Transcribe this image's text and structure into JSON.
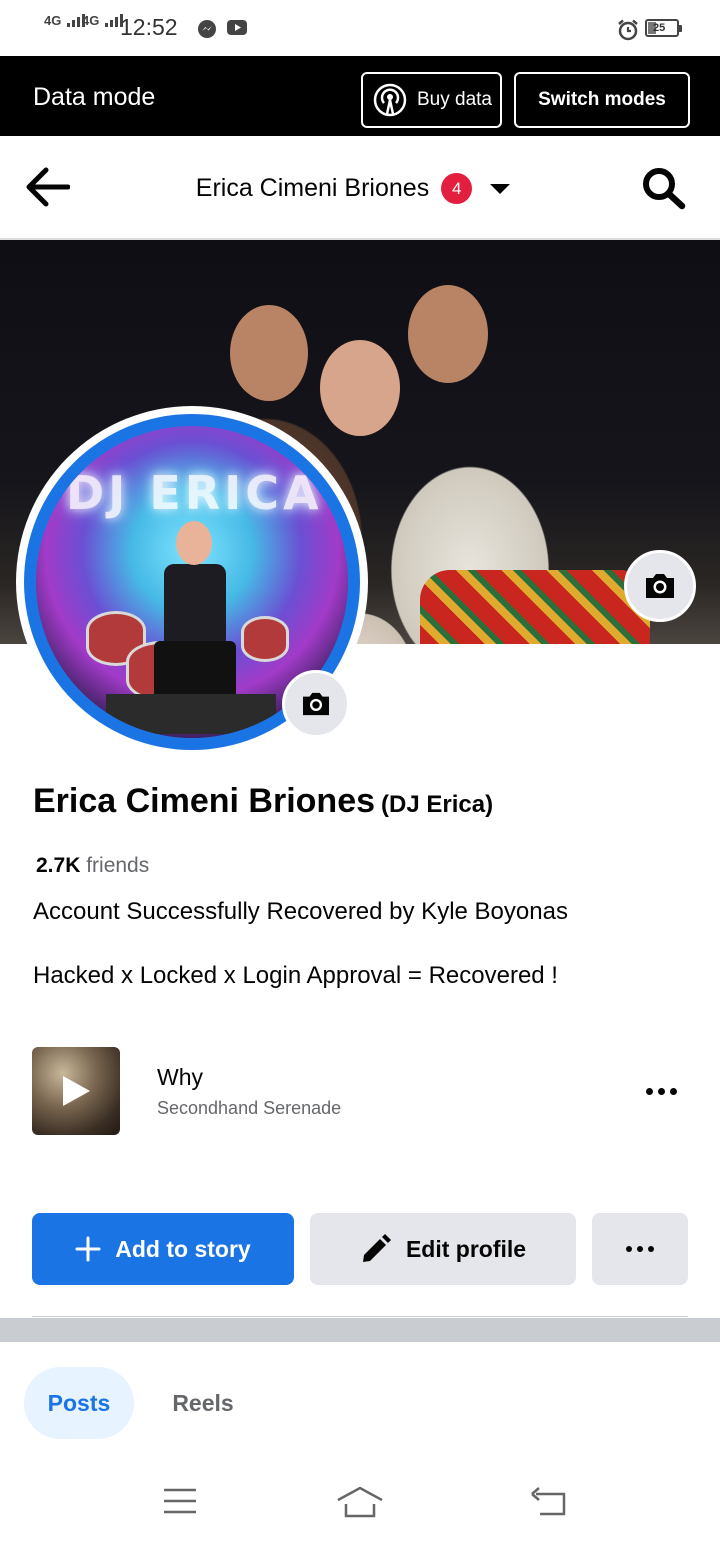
{
  "status_bar": {
    "sim1": "4G",
    "sim2": "4G",
    "time": "12:52",
    "battery": "25",
    "icons": [
      "messenger-icon",
      "youtube-icon",
      "alarm-icon",
      "battery-icon"
    ]
  },
  "data_mode_bar": {
    "title": "Data mode",
    "buy_label": "Buy data",
    "switch_label": "Switch modes"
  },
  "header": {
    "title": "Erica Cimeni Briones",
    "badge_count": "4"
  },
  "profile": {
    "name": "Erica Cimeni Briones",
    "alt_name": "(DJ Erica)",
    "friends_count": "2.7K",
    "friends_label": "friends",
    "bio_line1": "Account Successfully Recovered by Kyle Boyonas",
    "bio_line2": "Hacked x Locked x Login Approval = Recovered !",
    "avatar_sign": "DJ ERICA"
  },
  "music": {
    "title": "Why",
    "artist": "Secondhand Serenade"
  },
  "actions": {
    "add_story": "Add to story",
    "edit_profile": "Edit profile"
  },
  "tabs": [
    {
      "label": "Posts",
      "active": true
    },
    {
      "label": "Reels",
      "active": false
    }
  ],
  "colors": {
    "accent": "#1b74e4",
    "badge": "#e41e3f",
    "secondary_button": "#e4e6eb",
    "text_secondary": "#65676b"
  }
}
